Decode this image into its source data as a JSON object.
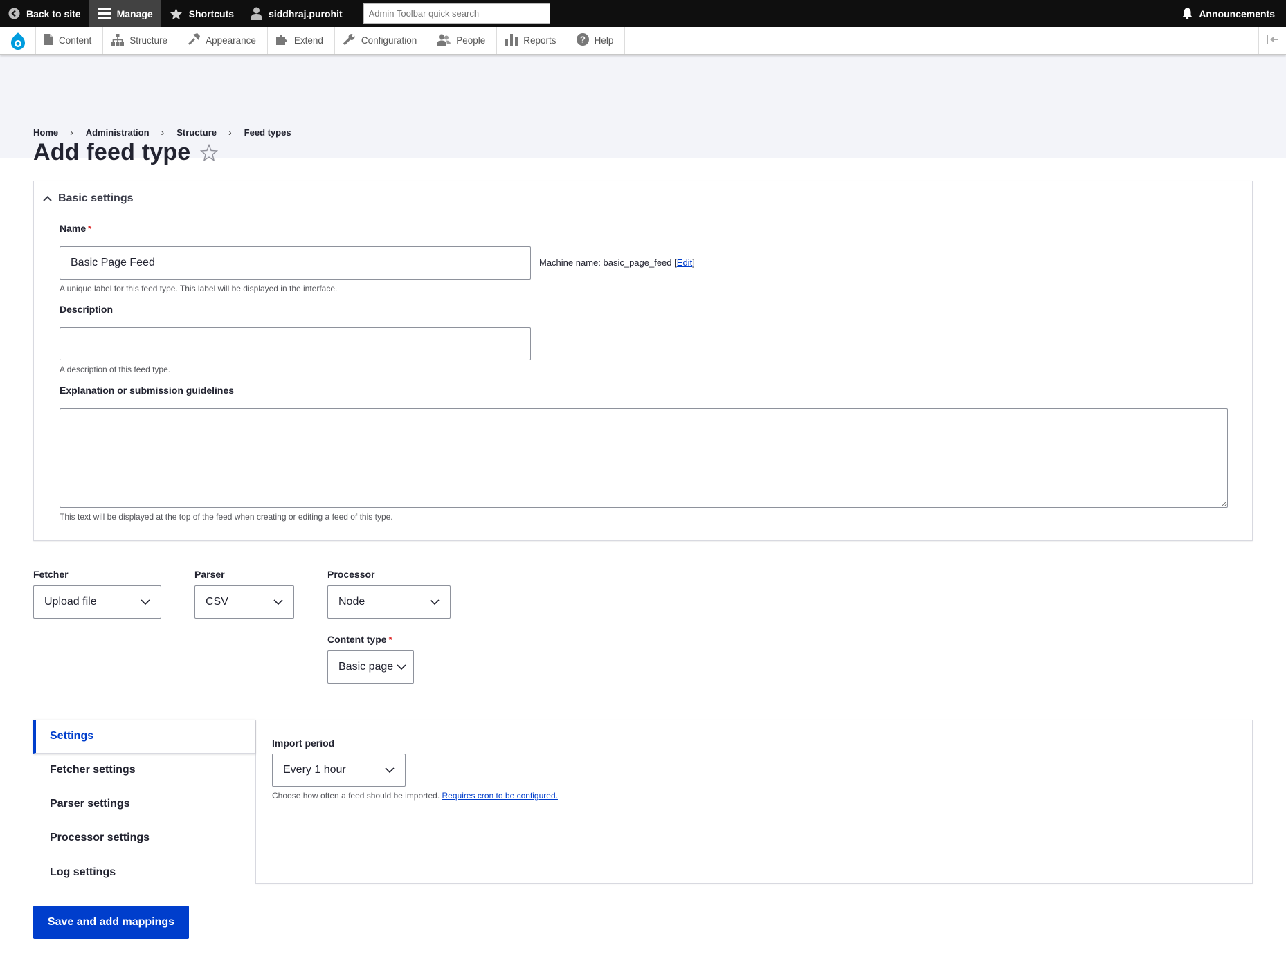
{
  "toolbar": {
    "back_label": "Back to site",
    "manage_label": "Manage",
    "shortcuts_label": "Shortcuts",
    "user_label": "siddhraj.purohit",
    "search_placeholder": "Admin Toolbar quick search",
    "announcements_label": "Announcements"
  },
  "tray": {
    "items": [
      {
        "label": "Content",
        "icon": "content-icon"
      },
      {
        "label": "Structure",
        "icon": "structure-icon"
      },
      {
        "label": "Appearance",
        "icon": "appearance-icon"
      },
      {
        "label": "Extend",
        "icon": "extend-icon"
      },
      {
        "label": "Configuration",
        "icon": "configuration-icon"
      },
      {
        "label": "People",
        "icon": "people-icon"
      },
      {
        "label": "Reports",
        "icon": "reports-icon"
      },
      {
        "label": "Help",
        "icon": "help-icon"
      }
    ]
  },
  "breadcrumb": [
    "Home",
    "Administration",
    "Structure",
    "Feed types"
  ],
  "page_title": "Add feed type",
  "basic_settings": {
    "summary": "Basic settings",
    "name_label": "Name",
    "name_value": "Basic Page Feed",
    "machine_prefix": "Machine name: basic_page_feed",
    "machine_edit": "Edit",
    "name_desc": "A unique label for this feed type. This label will be displayed in the interface.",
    "description_label": "Description",
    "description_value": "",
    "description_desc": "A description of this feed type.",
    "help_label": "Explanation or submission guidelines",
    "help_value": "",
    "help_desc": "This text will be displayed at the top of the feed when creating or editing a feed of this type."
  },
  "plugins": {
    "fetcher_label": "Fetcher",
    "fetcher_value": "Upload file",
    "parser_label": "Parser",
    "parser_value": "CSV",
    "processor_label": "Processor",
    "processor_value": "Node",
    "content_type_label": "Content type",
    "content_type_value": "Basic page"
  },
  "vertical_tabs": {
    "tabs": [
      "Settings",
      "Fetcher settings",
      "Parser settings",
      "Processor settings",
      "Log settings"
    ],
    "selected": "Settings",
    "import_period_label": "Import period",
    "import_period_value": "Every 1 hour",
    "import_desc": "Choose how often a feed should be imported.",
    "import_link": "Requires cron to be configured."
  },
  "submit_label": "Save and add mappings",
  "colors": {
    "accent": "#003ecc",
    "toolbar_bg": "#0f0f0f",
    "header_bg": "#f3f4f9",
    "required": "#dc2323"
  }
}
